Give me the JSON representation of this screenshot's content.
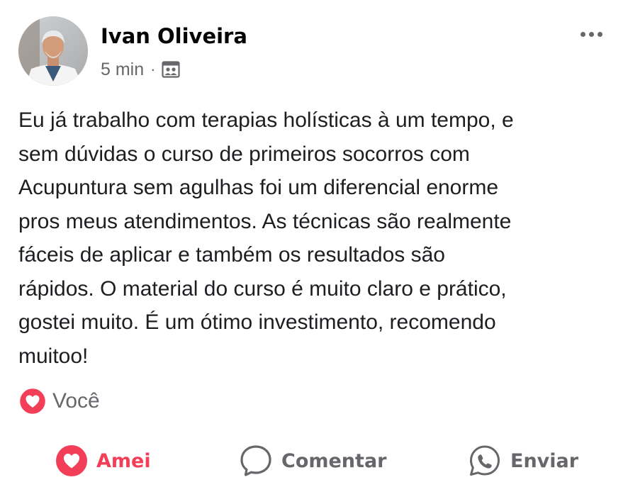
{
  "post": {
    "author": "Ivan Oliveira",
    "time": "5 min",
    "separator": "·",
    "audience_icon": "public-group-icon",
    "text_lines": [
      "Eu já trabalho com terapias holísticas à um tempo, e",
      "sem dúvidas o curso de primeiros socorros com",
      "Acupuntura sem agulhas foi um diferencial enorme",
      "pros meus atendimentos. As técnicas são realmente",
      "fáceis de aplicar e também os resultados são",
      "rápidos. O material do curso é muito claro e prático,",
      "gostei muito. É um ótimo investimento, recomendo",
      "muitoo!"
    ]
  },
  "reactions": {
    "icon": "heart-reaction-icon",
    "label": "Você"
  },
  "actions": {
    "love_label": "Amei",
    "comment_label": "Comentar",
    "share_label": "Enviar"
  },
  "colors": {
    "love": "#f33e58",
    "secondary_text": "#65676b",
    "primary_text": "#1c1e21"
  }
}
